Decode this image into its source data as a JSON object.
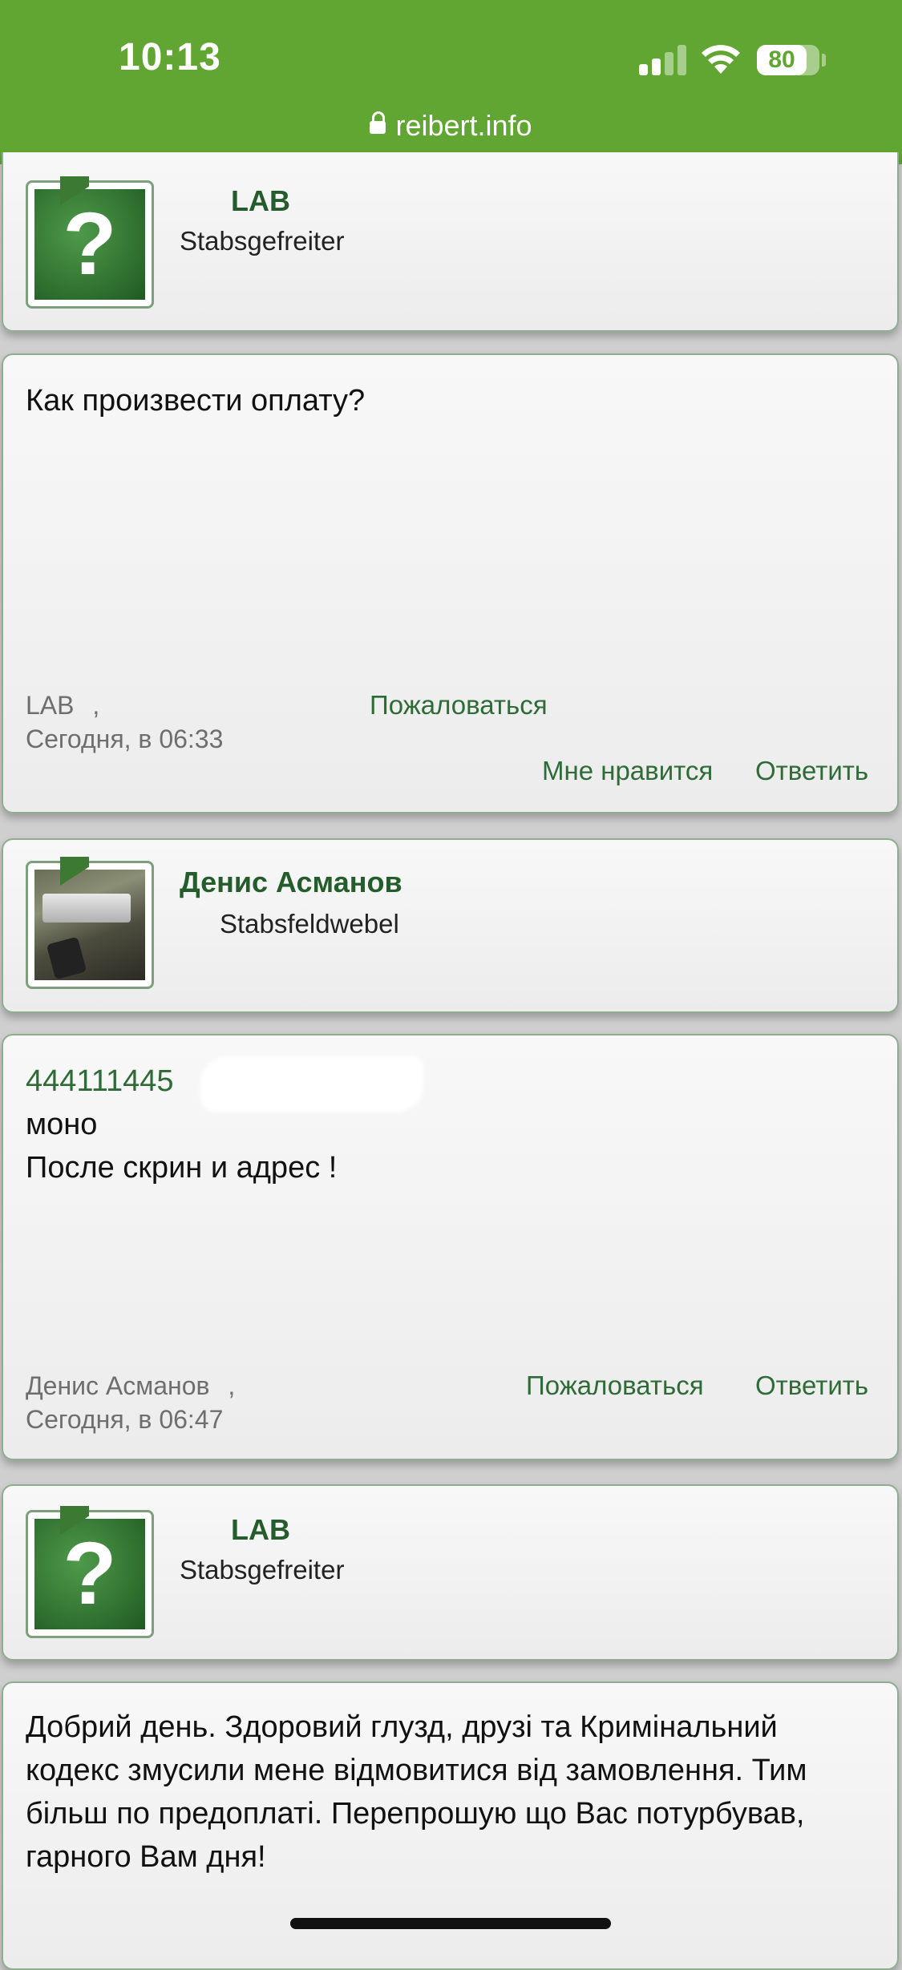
{
  "status": {
    "time": "10:13",
    "battery": "80"
  },
  "browser": {
    "url": "reibert.info"
  },
  "posts": [
    {
      "author": {
        "name": "LAB",
        "rank": "Stabsgefreiter"
      },
      "body": "Как произвести оплату?",
      "meta_author": "LAB",
      "meta_comma": ",",
      "meta_time": "Сегодня, в 06:33",
      "actions": {
        "report": "Пожаловаться",
        "like": "Мне нравится",
        "reply": "Ответить"
      }
    },
    {
      "author": {
        "name": "Денис Асманов",
        "rank": "Stabsfeldwebel"
      },
      "body_lines": [
        "444111445",
        "моно",
        "После скрин и адрес !"
      ],
      "meta_author": "Денис Асманов",
      "meta_comma": ",",
      "meta_time": "Сегодня, в 06:47",
      "actions": {
        "report": "Пожаловаться",
        "reply": "Ответить"
      }
    },
    {
      "author": {
        "name": "LAB",
        "rank": "Stabsgefreiter"
      },
      "body": "Добрий день. Здоровий глузд, друзі та Кримінальний кодекс змусили мене відмовитися від замовлення. Тим більш по предоплаті. Перепрошую що Вас потурбував, гарного Вам дня!"
    }
  ]
}
